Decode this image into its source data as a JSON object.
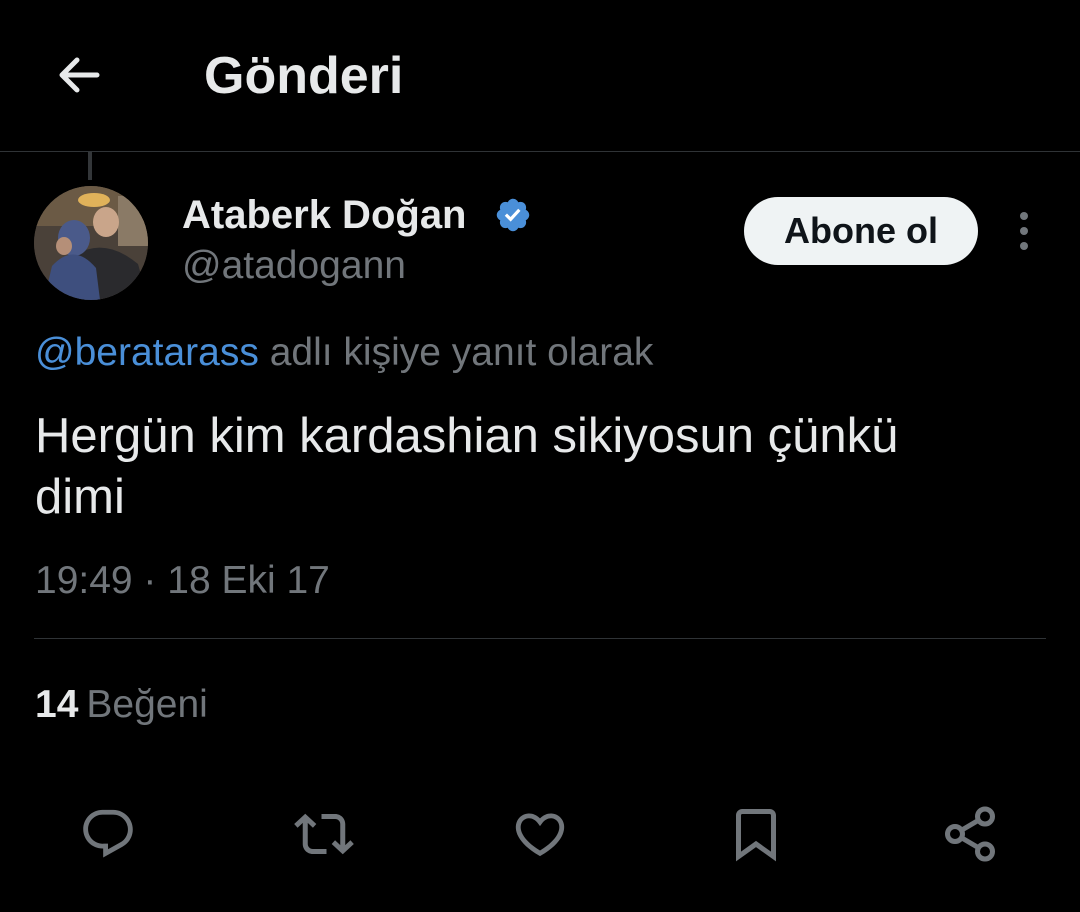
{
  "header": {
    "title": "Gönderi",
    "back_icon": "arrow-left-icon"
  },
  "tweet": {
    "author": {
      "display_name": "Ataberk Doğan",
      "handle": "@atadogann",
      "verified_icon": "verified-badge-icon",
      "verified_color": "#4a8fd8"
    },
    "follow_label": "Abone ol",
    "more_icon": "more-vertical-icon",
    "reply_to": {
      "mention": "@beratarass",
      "suffix": "adlı kişiye yanıt olarak"
    },
    "text": "Hergün kim kardashian sikiyosun çünkü\ndimi",
    "timestamp": "19:49 · 18 Eki 17"
  },
  "stats": {
    "likes_count": "14",
    "likes_label": "Beğeni"
  },
  "actions": {
    "reply_icon": "reply-icon",
    "retweet_icon": "retweet-icon",
    "like_icon": "heart-icon",
    "bookmark_icon": "bookmark-icon",
    "share_icon": "share-icon"
  },
  "colors": {
    "background": "#000000",
    "text_primary": "#e7e9ea",
    "text_secondary": "#71767b",
    "link": "#4a8fd8",
    "divider": "#2f3336",
    "follow_button_bg": "#eff3f4"
  }
}
